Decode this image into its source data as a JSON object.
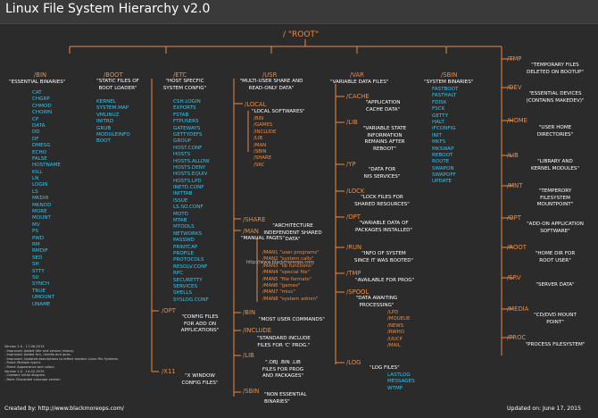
{
  "title": "Linux File System Hierarchy v2.0",
  "root": "/ \"ROOT\"",
  "bin": {
    "header": "/BIN",
    "desc": "\"ESSENTIAL BINARIES\"",
    "items": [
      "CAT",
      "CHGRP",
      "CHMOD",
      "CHOWN",
      "CP",
      "DATA",
      "DD",
      "DF",
      "DMESG",
      "ECHO",
      "FALSE",
      "HOSTNAME",
      "KILL",
      "LN",
      "LOGIN",
      "LS",
      "MKDIR",
      "MKNOD",
      "MORE",
      "MOUNT",
      "MV",
      "PS",
      "PWD",
      "RM",
      "RMDIF",
      "SED",
      "SH",
      "STTY",
      "SU",
      "SYNCH",
      "TRUE",
      "UMOUNT",
      "UNAME"
    ]
  },
  "boot": {
    "header": "/BOOT",
    "desc": "\"STATIC FILES OF\nBOOT LOADER\"",
    "items": [
      "KERNEL",
      "SYSTEM.MAP",
      "VMLINUZ",
      "INITRD",
      "GRUB",
      "MODULEINFO",
      "BOOT"
    ]
  },
  "etc": {
    "header": "/ETC",
    "desc": "\"HOST SPECFIC\nSYSTEM CONFIG\"",
    "items": [
      "CSH.LOGIN",
      "EXPORTS",
      "FSTAB",
      "FTPUSERS",
      "GATEWAYS",
      "GETTYDEFS",
      "GROUP",
      "HOST.CONF",
      "HOSTS",
      "HOSTS.ALLOW",
      "HOSTS.DENY",
      "HOSTS.EQUIV",
      "HOSTS.LPD",
      "INETD.CONF",
      "INITTAB",
      "ISSUE",
      "LS.SO.CONF",
      "MOTD",
      "MTAB",
      "MTOOLS",
      "NETWORKS",
      "PASSWD",
      "PRINTCAP",
      "PROFILE",
      "PROTOCOLS",
      "RESOLV.CONF",
      "RPC",
      "SECURETTY",
      "SERVICES",
      "SHELLS",
      "SYSLOG.CONF"
    ],
    "opt": {
      "header": "/OPT",
      "desc": "\"CONFIG FILES\nFOR ADD ON\nAPPLICATIONS\""
    },
    "x11": {
      "header": "/X11",
      "desc": "\"X WINDOW\nCONFIG FILES\""
    }
  },
  "usr": {
    "header": "/USR",
    "desc": "\"MULTI-USER SHARE AND\nREAD-ONLY DATA\"",
    "local": {
      "header": "/LOCAL",
      "desc": "\"LOCAL SOFTWARES\"",
      "items": [
        "/BIN",
        "/GAMES",
        "/INCLUDE",
        "/LIB",
        "/MAN",
        "/SBIN",
        "/SHARE",
        "/SRC"
      ]
    },
    "share": {
      "header": "/SHARE",
      "desc": "\"ARCHITECTURE\nINDEPENDENT SHARED\nDATA\""
    },
    "man": {
      "header": "/MAN",
      "desc": "\"MANUAL PAGES\"",
      "items": [
        "/MAN1 \"user programs\"",
        "/MAN2 \"system calls\"",
        "/MAN3 \"lib functions\"",
        "/MAN4 \"special file\"",
        "/MAN5 \"file formats\"",
        "/MAN6 \"games\"",
        "/MAN7 \"misc\"",
        "/MAN8 \"system admin\""
      ]
    },
    "bin": {
      "header": "/BIN",
      "desc": "\"MOST USER COMMANDS\""
    },
    "include": {
      "header": "/INCLUDE",
      "desc": "\"STANDARD INCLUDE\nFILES FOR 'C' PROG.\""
    },
    "lib": {
      "header": "/LIB",
      "desc": "\".OBJ .BIN .LIB\nFILES FOR PROG\nAND PACKAGES\""
    },
    "sbin": {
      "header": "/SBIN",
      "desc": "\"NON ESSENTIAL\nBINARIES\""
    }
  },
  "var": {
    "header": "/VAR",
    "desc": "\"VARIABLE DATA FILES\"",
    "cache": {
      "header": "/CACHE",
      "desc": "\"APPLICATION\nCACHE DATA\""
    },
    "lib": {
      "header": "/LIB",
      "desc": "\"VARIABLE STATE\nINFORMATION\nREMAINS AFTER\nREBOOT\""
    },
    "yp": {
      "header": "/YP",
      "desc": "\"DATA FOR\nNIS SERVICES\""
    },
    "lock": {
      "header": "/LOCK",
      "desc": "\"LOCK FILES FOR\nSHARED RESOURCES\""
    },
    "opt": {
      "header": "/OPT",
      "desc": "\"VARIABLE DATA OF\nPACKAGES INSTALLED\""
    },
    "run": {
      "header": "/RUN",
      "desc": "\"INFO OF SYSTEM\nSINCE IT WAS BOOTED\""
    },
    "tmp": {
      "header": "/TMP",
      "desc": "\"AVAILABLE FOR PROG\""
    },
    "spool": {
      "header": "/SPOOL",
      "desc": "\"DATA AWAITING\nPROCESSING\"",
      "items": [
        "/LPD",
        "/MQUEUE",
        "/NEWS",
        "/RWHO",
        "/UUCP",
        "/MAIL"
      ]
    },
    "log": {
      "header": "/LOG",
      "desc": "\"LOG FILES\"",
      "items": [
        "LASTLOG",
        "MESSAGES",
        "WTMP"
      ]
    }
  },
  "sbin": {
    "header": "/SBIN",
    "desc": "\"SYSTEM BINARIES\"",
    "items": [
      "FASTBOOT",
      "FASTHALT",
      "FDISK",
      "FSCK",
      "GETTY",
      "HALT",
      "IFCONFIG",
      "INIT",
      "MKFS",
      "MKSWAP",
      "REBOOT",
      "ROUTE",
      "SWAPON",
      "SWAPOFF",
      "UPDATE"
    ]
  },
  "right": [
    {
      "header": "/TMP",
      "desc": "\"TEMPORARY FILES\nDELETED ON BOOTUP\""
    },
    {
      "header": "/DEV",
      "desc": "\"ESSENTIAL DEVICES\n(CONTAINS MAKEDEV)\""
    },
    {
      "header": "/HOME",
      "desc": "\"USER HOME\nDIRECTORIES\""
    },
    {
      "header": "/LIB",
      "desc": "\"LIBRARY AND\nKERNEL MODULES\""
    },
    {
      "header": "/MNT",
      "desc": "\"TEMPERORY\nFILESYSTEM\nMOUNTPOINT\""
    },
    {
      "header": "/OPT",
      "desc": "\"ADD-ON APPLICATION\nSOFTWARE\""
    },
    {
      "header": "/ROOT",
      "desc": "\"HOME DIR FOR\nROOT USER\""
    },
    {
      "header": "/SRV",
      "desc": "\"SERVER DATA\""
    },
    {
      "header": "/MEDIA",
      "desc": "\"CD/DVD MOUNT\nPOINT\""
    },
    {
      "header": "/PROC",
      "desc": "\"PROCESS FILESYSTEM\""
    }
  ],
  "version_notes": "Version 2.0 - 17-06-2015\n- Improved: Added title and version history.\n- Improved: Added /srv, /media and /proc.\n- Improved: Updated descriptions to reflect modern Linux File Systems.\n- Fixed: Multiple typo's.\n- Fixed: Appearance and colour.\nVersion 1.0 - 14-02-2015\n- Created: Initial diagram.\n- Note: Discarded inkscape version",
  "watermark": "http://www.blackmoreops.com",
  "footer": {
    "created": "Created by: http://www.blackmoreops.com/",
    "updated": "Updated on: June 17, 2015"
  },
  "colors": {
    "background": "#2b2b2b",
    "accent": "#f08a3c",
    "list": "#35c4ee",
    "text": "#ffffff"
  }
}
